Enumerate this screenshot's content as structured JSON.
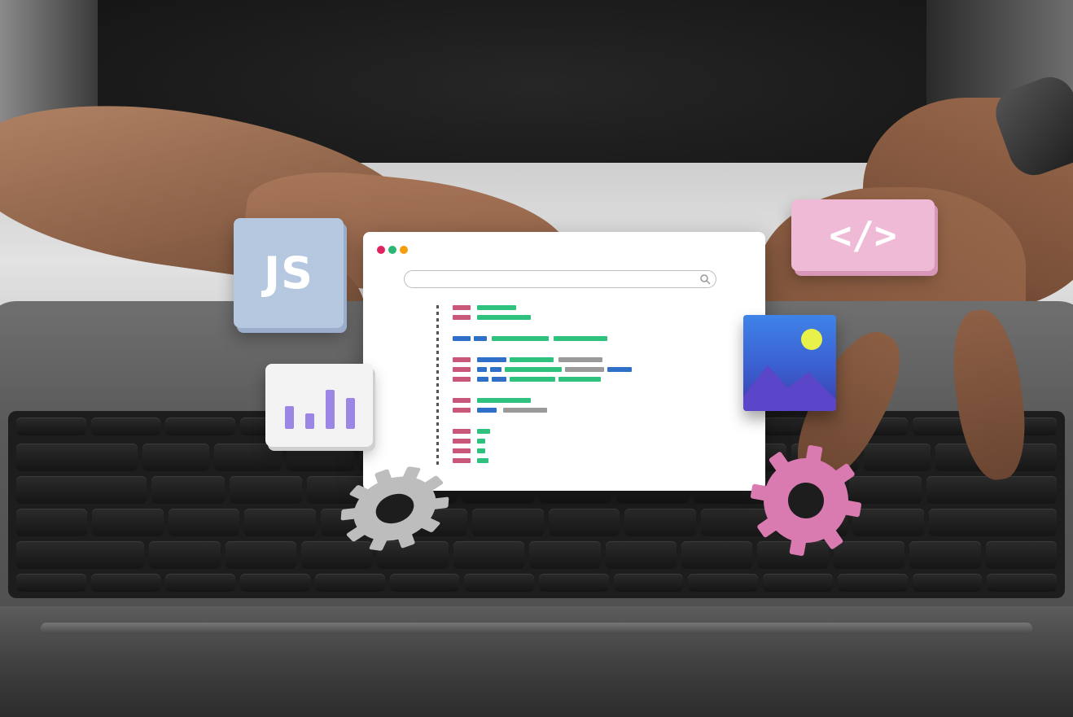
{
  "js_tile": {
    "label": "JS",
    "color": "#b6c8e0"
  },
  "code_tile": {
    "label": "</>",
    "color": "#eebad6"
  },
  "browser_window": {
    "window_dots": [
      "#e0245e",
      "#2bb673",
      "#f59e0b"
    ],
    "code_colors": {
      "keyword": "#c9577a",
      "string": "#2ec27e",
      "identifier": "#2f6fc7",
      "comment": "#9a9a9a"
    }
  },
  "chart_tile": {
    "bar_color": "#9b86e6",
    "bar_levels": [
      0.45,
      0.3,
      0.78,
      0.62
    ]
  },
  "image_tile": {
    "sun_color": "#e8f04a",
    "mountain_color": "#5b45c8"
  },
  "gears": {
    "left_color": "#bdbdbd",
    "right_color": "#d97bb0"
  },
  "icons": [
    "js-tile-icon",
    "chart-icon",
    "image-icon",
    "code-tag-icon",
    "gear-icon",
    "search-icon"
  ]
}
